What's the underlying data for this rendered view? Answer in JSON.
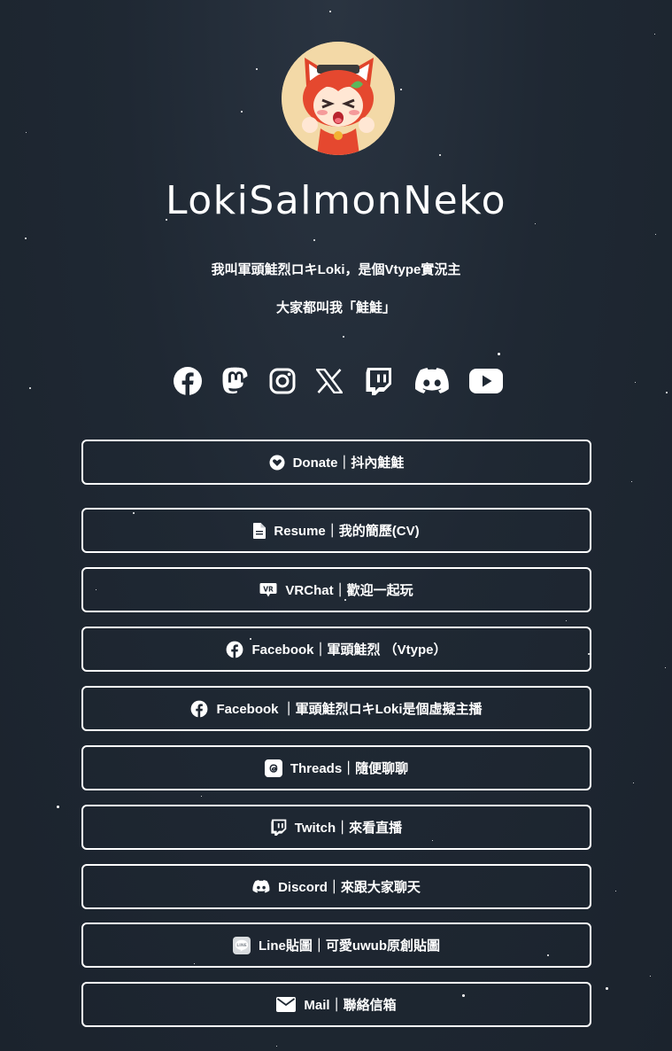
{
  "profile": {
    "name": "LokiSalmonNeko",
    "bio_line1": "我叫軍頭鮭烈ロキLoki，是個Vtype實況主",
    "bio_line2": "大家都叫我「鮭鮭」",
    "avatar_icon": "cartoon-cat-girl-avatar"
  },
  "socials": [
    {
      "name": "facebook",
      "icon": "facebook-icon"
    },
    {
      "name": "mastodon",
      "icon": "mastodon-icon"
    },
    {
      "name": "instagram",
      "icon": "instagram-icon"
    },
    {
      "name": "x",
      "icon": "x-icon"
    },
    {
      "name": "twitch",
      "icon": "twitch-icon"
    },
    {
      "name": "discord",
      "icon": "discord-icon"
    },
    {
      "name": "youtube",
      "icon": "youtube-icon"
    }
  ],
  "links": [
    {
      "label": "Donate｜抖內鮭鮭",
      "icon": "heart-circle-icon"
    },
    {
      "label": "Resume｜我的簡歷(CV)",
      "icon": "document-icon"
    },
    {
      "label": "VRChat｜歡迎一起玩",
      "icon": "vrchat-icon"
    },
    {
      "label": "Facebook｜軍頭鮭烈 （Vtype）",
      "icon": "facebook-icon"
    },
    {
      "label": "Facebook ｜軍頭鮭烈ロキLoki是個虛擬主播",
      "icon": "facebook-icon"
    },
    {
      "label": "Threads｜隨便聊聊",
      "icon": "threads-icon"
    },
    {
      "label": "Twitch｜來看直播",
      "icon": "twitch-icon"
    },
    {
      "label": "Discord｜來跟大家聊天",
      "icon": "discord-icon"
    },
    {
      "label": "Line貼圖｜可愛uwub原創貼圖",
      "icon": "line-icon"
    },
    {
      "label": "Mail｜聯絡信箱",
      "icon": "mail-icon"
    }
  ],
  "colors": {
    "background": "#1f2833",
    "text": "#ffffff",
    "button_border": "#ffffff",
    "avatar_bg": "#f3d9a7"
  }
}
